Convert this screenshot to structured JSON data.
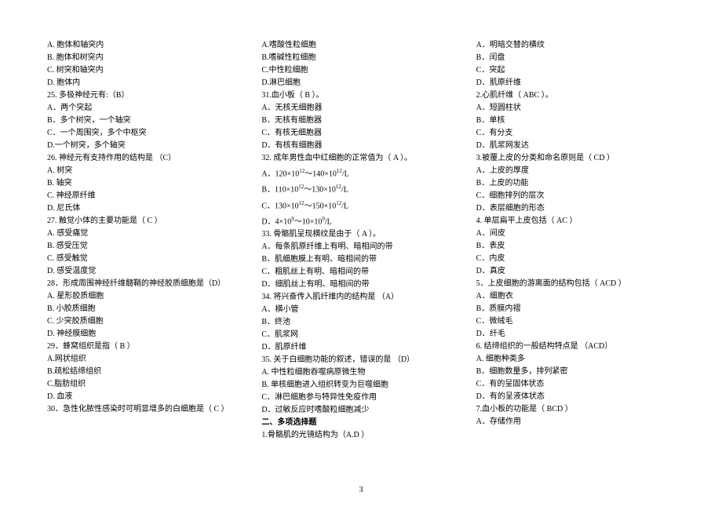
{
  "columns": [
    [
      "A. 胞体和轴突内",
      "B. 胞体和树突内",
      "C. 树突和轴突内",
      "D. 胞体内",
      "25. 多极神经元有:（B）",
      "A．两个突起",
      "B．多个树突，一个轴突",
      "C．一个周围突，多个中枢突",
      "D.一个树突，多个轴突",
      "26. 神经元有支持作用的结构是 （C）",
      "A. 树突",
      "B. 轴突",
      "C. 神经原纤维",
      "D. 尼氏体",
      "27. 触觉小体的主要功能是（ C    ）",
      "A. 感受痛觉",
      "B. 感受压觉",
      "C. 感受触觉",
      "D. 感受温度觉",
      "28．形成周围神经纤维髓鞘的神经胶质细胞是（D）",
      "A. 星形胶质细胞",
      "B. 小胶质细胞",
      "C. 少突胶质细胞",
      "D. 神经膜细胞",
      "29．蜂窝组织是指（ B  ）",
      "A.网状组织",
      "B.疏松结缔组织",
      "C.脂肪组织",
      "D. 血液",
      "30．急性化脓性感染时可明显增多的白细胞是（ C  ）"
    ],
    [
      "A.嗜酸性粒细胞",
      "B.嗜碱性粒细胞",
      "C.中性粒细胞",
      "D.淋巴细胞",
      "31.血小板（    B   ）。",
      "A．无核无细胞器",
      "B．无核有细胞器",
      "C．有核无细胞器",
      "D．有核有细胞器",
      "32. 成年男性血中红细胞的正常值为（   A   ）。",
      "A．120×10^12^～140×10^12^/L",
      "B．110×10^12^～130×10^12^/L",
      "C．130×10^12^～150×10^12^/L",
      "D．4×10^9^～10×10^9^/L",
      "33. 骨骼肌呈现横纹是由于（     A    ）。",
      "A．每条肌原纤维上有明、暗相间的带",
      "B．肌细胞膜上有明、暗相间的带",
      "C．粗肌丝上有明、暗相间的带",
      "D．细肌丝上有明、暗相间的带",
      "34. 将兴奋传入肌纤维内的结构是  （A）",
      "A．横小管",
      "B．终池",
      "C．肌浆网",
      "D．肌原纤维",
      "35. 关于白细胞功能的叙述，错误的是  （D）",
      "A. 中性粒细胞吞噬病原微生物",
      "B. 单核细胞进入组织转变为巨噬细胞",
      "C．淋巴细胞参与特异性免疫作用",
      "D．过敏反应时嗜酸粒细胞减少",
      "__二、多项选择题__",
      "1.骨骼肌的光镜结构为（A.D    ）"
    ],
    [
      "A．明暗交替的横纹",
      "B．闰盘",
      "C．突起",
      "D．肌原纤维",
      "2.心肌纤维（   ABC    ）。",
      "A．短圆柱状",
      "B．单核",
      "C．有分支",
      "D．肌浆网发达",
      "3.被覆上皮的分类和命名原则是（    CD      ）",
      "A．上皮的厚度",
      "B．上皮的功能",
      "C．细胞排列的层次",
      "D．表层细胞的形态",
      "4. 单层扁平上皮包括（       AC         ）",
      "A．间皮",
      "B．表皮",
      "C．内皮",
      "D．真皮",
      "5．上皮细胞的游离面的结构包括（       ACD      ）",
      "A．细胞衣",
      "B．质膜内褶",
      "C．微绒毛",
      "D．纤毛",
      "6. 结缔组织的一般结构特点是  （ACD）",
      "A. 细胞种类多",
      "B．细胞数量多，排列紧密",
      "C．有的呈固体状态",
      "D．有的呈液体状态",
      "7.血小板的功能是（   BCD       ）",
      "A．存储作用"
    ]
  ],
  "page_number": "3"
}
